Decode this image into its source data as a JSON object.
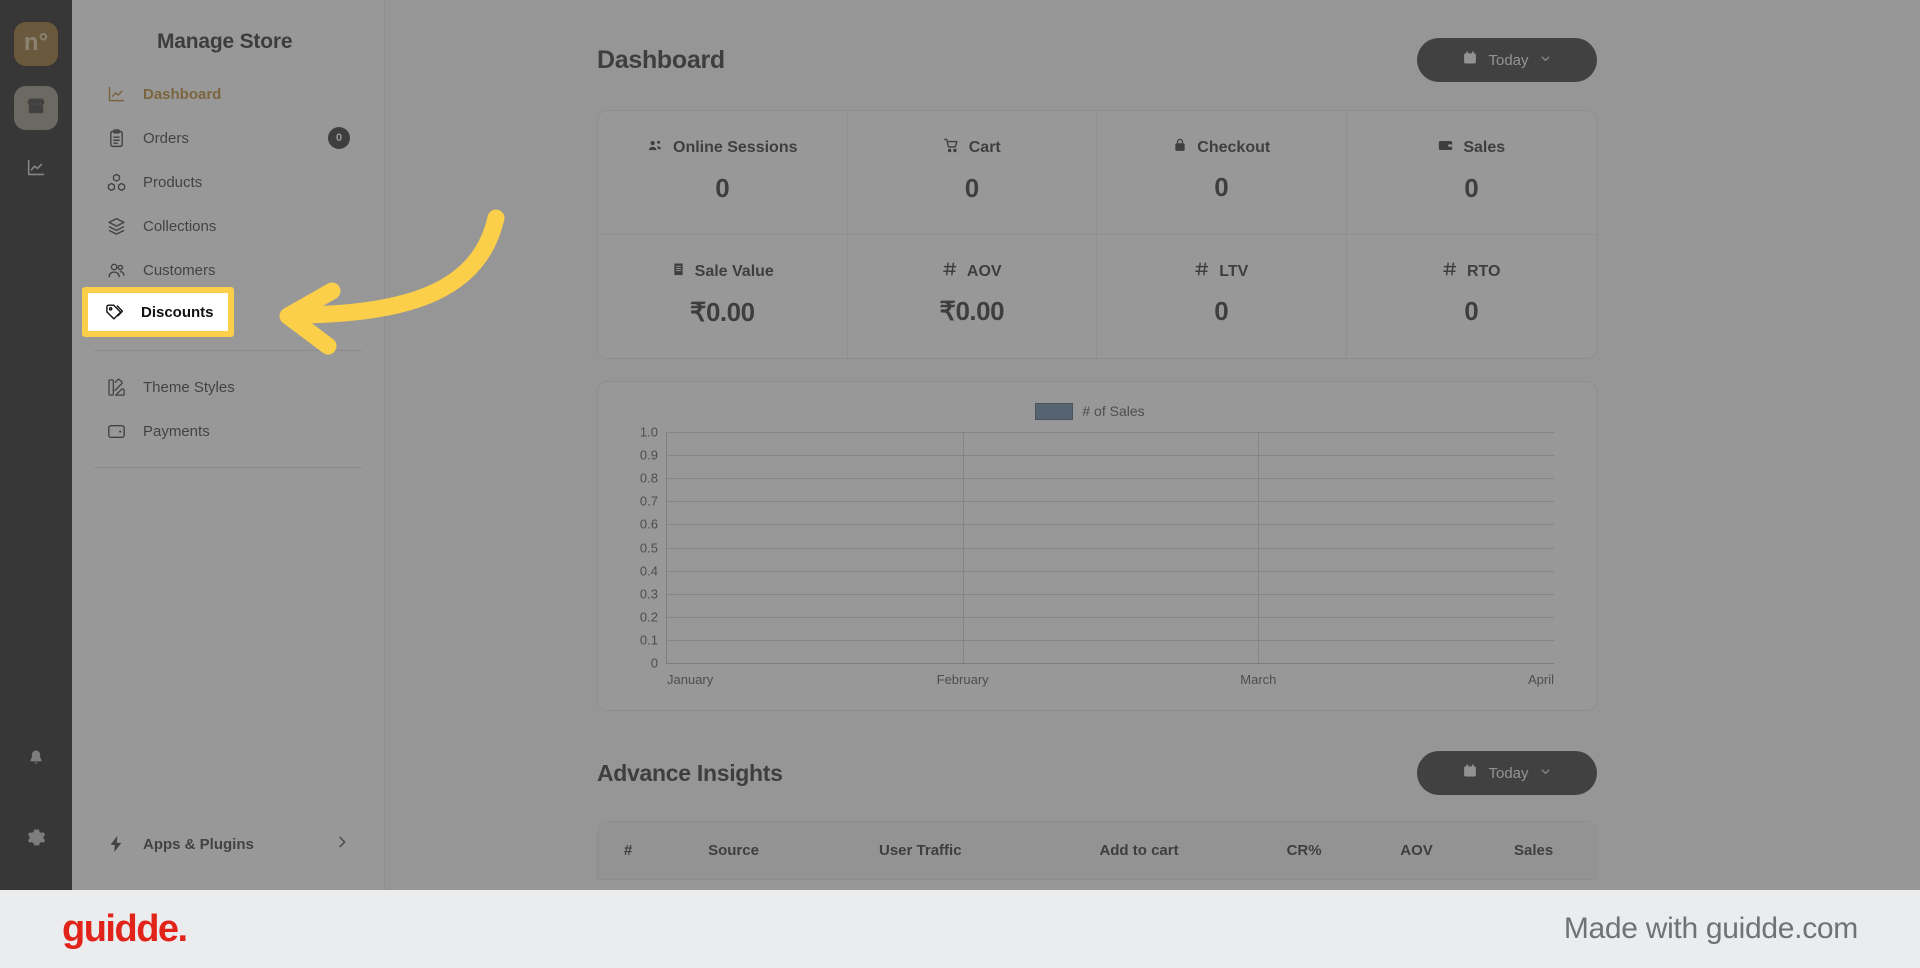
{
  "rail": {
    "logo_text": "n°",
    "items": [
      {
        "name": "store-icon",
        "label": "Store",
        "active": true
      },
      {
        "name": "analytics-icon",
        "label": "Analytics",
        "active": false
      }
    ],
    "bottom": [
      {
        "name": "bell-icon",
        "label": "Notifications"
      },
      {
        "name": "gear-icon",
        "label": "Settings"
      }
    ]
  },
  "sidebar": {
    "title": "Manage Store",
    "items": [
      {
        "label": "Dashboard",
        "icon": "chart-line-icon",
        "active": true,
        "badge": null
      },
      {
        "label": "Orders",
        "icon": "clipboard-icon",
        "active": false,
        "badge": "0"
      },
      {
        "label": "Products",
        "icon": "boxes-icon",
        "active": false,
        "badge": null
      },
      {
        "label": "Collections",
        "icon": "layers-icon",
        "active": false,
        "badge": null
      },
      {
        "label": "Customers",
        "icon": "users-icon",
        "active": false,
        "badge": null
      },
      {
        "label": "Discounts",
        "icon": "tag-icon",
        "active": false,
        "badge": null
      }
    ],
    "items_after_divider": [
      {
        "label": "Theme Styles",
        "icon": "palette-icon",
        "active": false,
        "badge": null
      },
      {
        "label": "Payments",
        "icon": "wallet-icon",
        "active": false,
        "badge": null
      }
    ],
    "footer": {
      "label": "Apps & Plugins",
      "icon": "bolt-icon",
      "chevron": "›"
    }
  },
  "main": {
    "page_title": "Dashboard",
    "date_filter": {
      "label": "Today",
      "icon": "calendar-icon",
      "chevron": "⌄"
    },
    "stats": [
      {
        "label": "Online Sessions",
        "icon": "people-icon",
        "value": "0"
      },
      {
        "label": "Cart",
        "icon": "cart-icon",
        "value": "0"
      },
      {
        "label": "Checkout",
        "icon": "lock-icon",
        "value": "0"
      },
      {
        "label": "Sales",
        "icon": "wallet-icon",
        "value": "0"
      },
      {
        "label": "Sale Value",
        "icon": "receipt-icon",
        "value": "₹0.00"
      },
      {
        "label": "AOV",
        "icon": "hash-icon",
        "value": "₹0.00"
      },
      {
        "label": "LTV",
        "icon": "hash-icon",
        "value": "0"
      },
      {
        "label": "RTO",
        "icon": "hash-icon",
        "value": "0"
      }
    ],
    "insights": {
      "title": "Advance Insights",
      "date_filter": {
        "label": "Today",
        "icon": "calendar-icon",
        "chevron": "⌄"
      },
      "columns": [
        "#",
        "Source",
        "User Traffic",
        "Add to cart",
        "CR%",
        "AOV",
        "Sales"
      ],
      "rows": []
    }
  },
  "chart_data": {
    "type": "bar",
    "title": "",
    "legend": [
      {
        "name": "# of Sales",
        "color": "#4f7897"
      }
    ],
    "legend_position": "top-center",
    "categories": [
      "January",
      "February",
      "March",
      "April"
    ],
    "series": [
      {
        "name": "# of Sales",
        "values": [
          0,
          0,
          0,
          0
        ]
      }
    ],
    "xlabel": "",
    "ylabel": "",
    "ylim": [
      0,
      1.0
    ],
    "yticks": [
      "1.0",
      "0.9",
      "0.8",
      "0.7",
      "0.6",
      "0.5",
      "0.4",
      "0.3",
      "0.2",
      "0.1",
      "0"
    ],
    "xticks": [
      "January",
      "February",
      "March",
      "April"
    ],
    "grid": true
  },
  "callout": {
    "highlight_label": "Discounts",
    "highlight_icon": "tag-icon",
    "highlight_color": "#fbcf49",
    "arrow_color": "#fbcf49"
  },
  "guidde": {
    "logo": "guidde.",
    "made_with": "Made with guidde.com",
    "logo_color": "#e2231a"
  }
}
